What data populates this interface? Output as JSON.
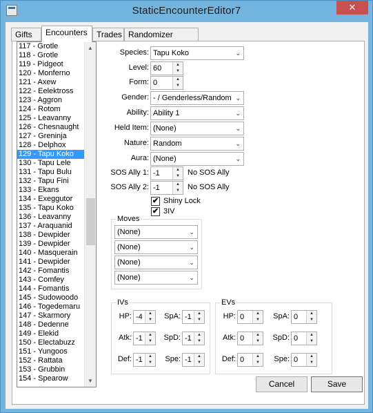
{
  "window": {
    "title": "StaticEncounterEditor7",
    "close": "✕"
  },
  "tabs": [
    "Gifts",
    "Encounters",
    "Trades",
    "Randomizer Options"
  ],
  "list": {
    "items": [
      "117 - Grotle",
      "118 - Grotle",
      "119 - Pidgeot",
      "120 - Monferno",
      "121 - Axew",
      "122 - Eelektross",
      "123 - Aggron",
      "124 - Rotom",
      "125 - Leavanny",
      "126 - Chesnaught",
      "127 - Greninja",
      "128 - Delphox",
      "129 - Tapu Koko",
      "130 - Tapu Lele",
      "131 - Tapu Bulu",
      "132 - Tapu Fini",
      "133 - Ekans",
      "134 - Exeggutor",
      "135 - Tapu Koko",
      "136 - Leavanny",
      "137 - Araquanid",
      "138 - Dewpider",
      "139 - Dewpider",
      "140 - Masquerain",
      "141 - Dewpider",
      "142 - Fomantis",
      "143 - Comfey",
      "144 - Fomantis",
      "145 - Sudowoodo",
      "146 - Togedemaru",
      "147 - Skarmory",
      "148 - Dedenne",
      "149 - Elekid",
      "150 - Electabuzz",
      "151 - Yungoos",
      "152 - Rattata",
      "153 - Grubbin",
      "154 - Spearow"
    ],
    "selected": "129 - Tapu Koko"
  },
  "labels": {
    "species": "Species:",
    "level": "Level:",
    "form": "Form:",
    "gender": "Gender:",
    "ability": "Ability:",
    "held_item": "Held Item:",
    "nature": "Nature:",
    "aura": "Aura:",
    "sos1": "SOS Ally 1:",
    "sos2": "SOS Ally 2:"
  },
  "fields": {
    "species": "Tapu Koko",
    "level": "60",
    "form": "0",
    "gender": "- / Genderless/Random",
    "ability": "Ability 1",
    "held_item": "(None)",
    "nature": "Random",
    "aura": "(None)",
    "sos1": "-1",
    "sos2": "-1",
    "sos1_text": "No SOS Ally",
    "sos2_text": "No SOS Ally"
  },
  "checks": {
    "shiny_lock": "Shiny Lock",
    "iv3": "3IV",
    "mark": "✔"
  },
  "moves": {
    "title": "Moves",
    "values": [
      "(None)",
      "(None)",
      "(None)",
      "(None)"
    ]
  },
  "ivs": {
    "title": "IVs",
    "hp_label": "HP:",
    "hp": "-4",
    "atk_label": "Atk:",
    "atk": "-1",
    "def_label": "Def:",
    "def": "-1",
    "spa_label": "SpA:",
    "spa": "-1",
    "spd_label": "SpD:",
    "spd": "-1",
    "spe_label": "Spe:",
    "spe": "-1"
  },
  "evs": {
    "title": "EVs",
    "hp_label": "HP:",
    "hp": "0",
    "atk_label": "Atk:",
    "atk": "0",
    "def_label": "Def:",
    "def": "0",
    "spa_label": "SpA:",
    "spa": "0",
    "spd_label": "SpD:",
    "spd": "0",
    "spe_label": "Spe:",
    "spe": "0"
  },
  "buttons": {
    "cancel": "Cancel",
    "save": "Save"
  },
  "icons": {
    "caret": "⌄",
    "up": "▲",
    "down": "▼"
  }
}
